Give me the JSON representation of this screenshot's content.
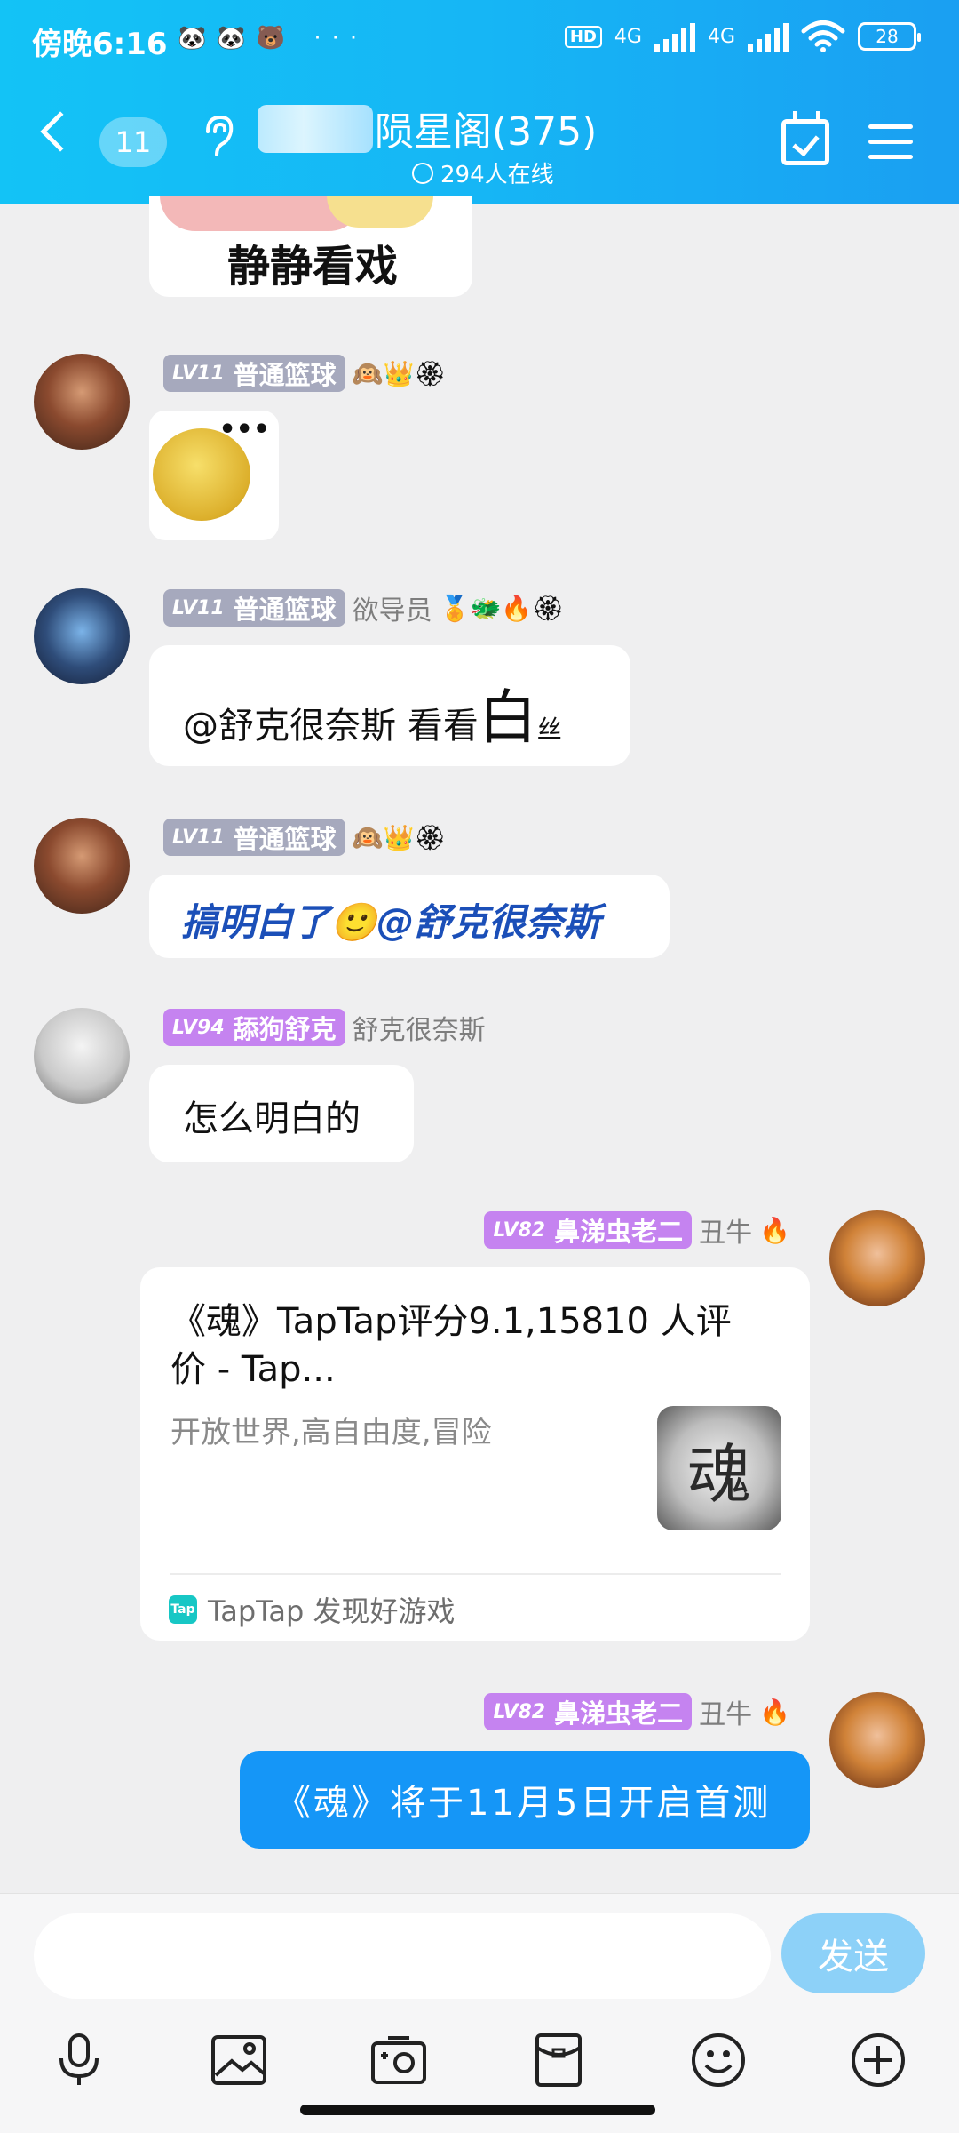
{
  "status_bar": {
    "time": "傍晚6:16",
    "notif_icons": "🐼🐼🐻 ···",
    "hd": "HD",
    "net1": "4G",
    "net2": "4G",
    "battery": "28"
  },
  "header": {
    "back_count": "11",
    "group_name": "陨星阁(375)",
    "online_text": "294人在线"
  },
  "chat": {
    "top_sticker_text": "静静看戏",
    "messages": [
      {
        "badge_level": "LV11",
        "badge_text": "普通篮球",
        "name": "",
        "emojis": "🙉👑🏵"
      },
      {
        "badge_level": "LV11",
        "badge_text": "普通篮球",
        "name": "欲导员",
        "emojis": "🏅🐲🔥🏵",
        "text_prefix": "@舒克很奈斯 看看",
        "text_big": "白",
        "text_small": "丝"
      },
      {
        "badge_level": "LV11",
        "badge_text": "普通篮球",
        "name": "",
        "emojis": "🙉👑🏵",
        "text": "搞明白了🙂@舒克很奈斯"
      },
      {
        "badge_level": "LV94",
        "badge_text": "舔狗舒克",
        "name": "舒克很奈斯",
        "text": "怎么明白的"
      },
      {
        "badge_level": "LV82",
        "badge_text": "鼻涕虫老二",
        "name": "丑牛",
        "emojis": "🔥",
        "link_title": "《魂》TapTap评分9.1,15810 人评价 - Tap...",
        "link_desc": "开放世界,高自由度,冒险",
        "link_thumb_char": "魂",
        "link_source_icon": "Tap",
        "link_source": "TapTap 发现好游戏"
      },
      {
        "badge_level": "LV82",
        "badge_text": "鼻涕虫老二",
        "name": "丑牛",
        "emojis": "🔥",
        "text": "《魂》将于11月5日开启首测"
      }
    ]
  },
  "input": {
    "placeholder": "",
    "send_label": "发送"
  },
  "toolbar_icons": [
    "microphone-icon",
    "image-icon",
    "camera-icon",
    "red-packet-icon",
    "emoji-icon",
    "plus-icon"
  ],
  "colors": {
    "header_start": "#13c3f6",
    "header_end": "#1a9ff2",
    "my_bubble": "#1596f7",
    "mention_text": "#1b4fb8",
    "badge_gray": "#a6a9bd",
    "badge_purple": "#c583f0",
    "send_button": "#8dd1f8"
  }
}
